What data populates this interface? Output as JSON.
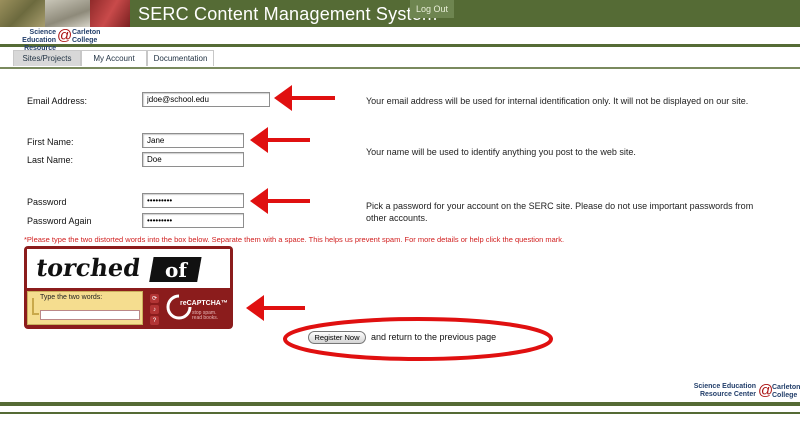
{
  "header": {
    "title": "SERC Content Management System",
    "logout_label": "Log Out"
  },
  "brand": {
    "line1": "Science Education",
    "line2": "Resource Center",
    "at": "@",
    "college1": "Carleton",
    "college2": "College"
  },
  "tabs": [
    {
      "label": "Sites/Projects",
      "active": true
    },
    {
      "label": "My Account",
      "active": false
    },
    {
      "label": "Documentation",
      "active": false
    }
  ],
  "form": {
    "email_label": "Email Address:",
    "email_value": "jdoe@school.edu",
    "email_help": "Your email address will be used for internal identification only. It will not be displayed on our site.",
    "first_name_label": "First Name:",
    "first_name_value": "Jane",
    "last_name_label": "Last Name:",
    "last_name_value": "Doe",
    "name_help": "Your name will be used to identify anything you post to the web site.",
    "password_label": "Password",
    "password_value": "•••••••••",
    "password_again_label": "Password Again",
    "password_again_value": "•••••••••",
    "password_help_line1": "Pick a password for your account on the SERC site. Please do not use important passwords from",
    "password_help_line2": "other accounts."
  },
  "captcha": {
    "note": "*Please type the two distorted words into the box below. Separate them with a space. This helps us prevent spam. For more details or help click the question mark.",
    "word1": "torched",
    "word2": "of",
    "input_label": "Type the two words:",
    "logo_text": "reCAPTCHA™",
    "tagline1": "stop spam.",
    "tagline2": "read books."
  },
  "actions": {
    "register_label": "Register Now",
    "return_text": "and return to the previous page"
  },
  "colors": {
    "header_green": "#556b35",
    "annotation_red": "#e01010",
    "captcha_red": "#8b1c1c"
  }
}
